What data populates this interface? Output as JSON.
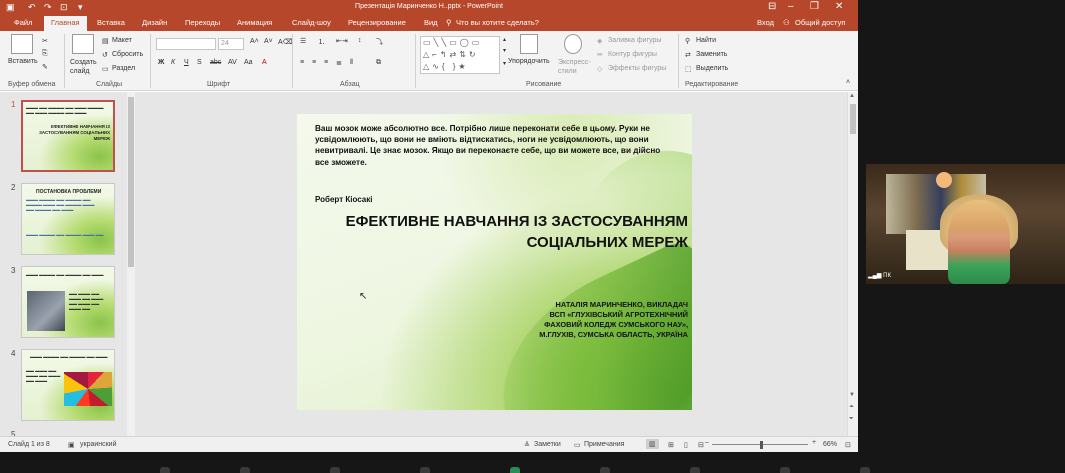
{
  "window": {
    "title": "Презентація Маринченко Н..pptx - PowerPoint",
    "login": "Вход",
    "share": "Общий доступ"
  },
  "tabs": [
    "Файл",
    "Главная",
    "Вставка",
    "Дизайн",
    "Переходы",
    "Анимация",
    "Слайд-шоу",
    "Рецензирование",
    "Вид",
    "Что вы хотите сделать?"
  ],
  "ribbon": {
    "paste": "Вставить",
    "create_slide": "Создать слайд",
    "layout": "Макет",
    "reset": "Сбросить",
    "section": "Раздел",
    "font_size": "24",
    "arrange": "Упорядочить",
    "quick_styles": "Экспресс-стили",
    "shape_fill": "Заливка фигуры",
    "shape_outline": "Контур фигуры",
    "shape_effects": "Эффекты фигуры",
    "find": "Найти",
    "replace": "Заменить",
    "select": "Выделить",
    "groups": {
      "clipboard": "Буфер обмена",
      "slides": "Слайды",
      "font": "Шрифт",
      "paragraph": "Абзац",
      "drawing": "Рисование",
      "editing": "Редактирование"
    }
  },
  "thumbnails": [
    {
      "num": "1",
      "title": "ЕФЕКТИВНЕ НАВЧАННЯ ІЗ ЗАСТОСУВАННЯМ СОЦІАЛЬНИХ МЕРЕЖ"
    },
    {
      "num": "2",
      "title": "ПОСТАНОВКА ПРОБЛЕМИ"
    },
    {
      "num": "3",
      "title": ""
    },
    {
      "num": "4",
      "title": ""
    },
    {
      "num": "5",
      "title": ""
    }
  ],
  "slide": {
    "quote": "Ваш мозок може абсолютно все. Потрібно лише переконати себе в цьому. Руки не усвідомлюють, що вони не вміють відтискатись, ноги не усвідомлюють, що вони невитривалі. Це знає мозок. Якщо ви переконаєте себе, що ви можете все, ви дійсно все зможете.",
    "author": "Роберт Кіосакі",
    "title": "ЕФЕКТИВНЕ НАВЧАННЯ ІЗ ЗАСТОСУВАННЯМ СОЦІАЛЬНИХ МЕРЕЖ",
    "byline_1": "НАТАЛІЯ МАРИНЧЕНКО, ВИКЛАДАЧ",
    "byline_2": "ВСП «ГЛУХІВСЬКИЙ АГРОТЕХНІЧНИЙ",
    "byline_3": "ФАХОВИЙ КОЛЕДЖ СУМСЬКОГО НАУ»,",
    "byline_4": "М.ГЛУХІВ, СУМСЬКА ОБЛАСТЬ, УКРАЇНА"
  },
  "status": {
    "slide_of": "Слайд 1 из 8",
    "language": "украинский",
    "notes": "Заметки",
    "comments": "Примечания",
    "zoom": "66%"
  },
  "webcam": {
    "label": "ПК"
  }
}
